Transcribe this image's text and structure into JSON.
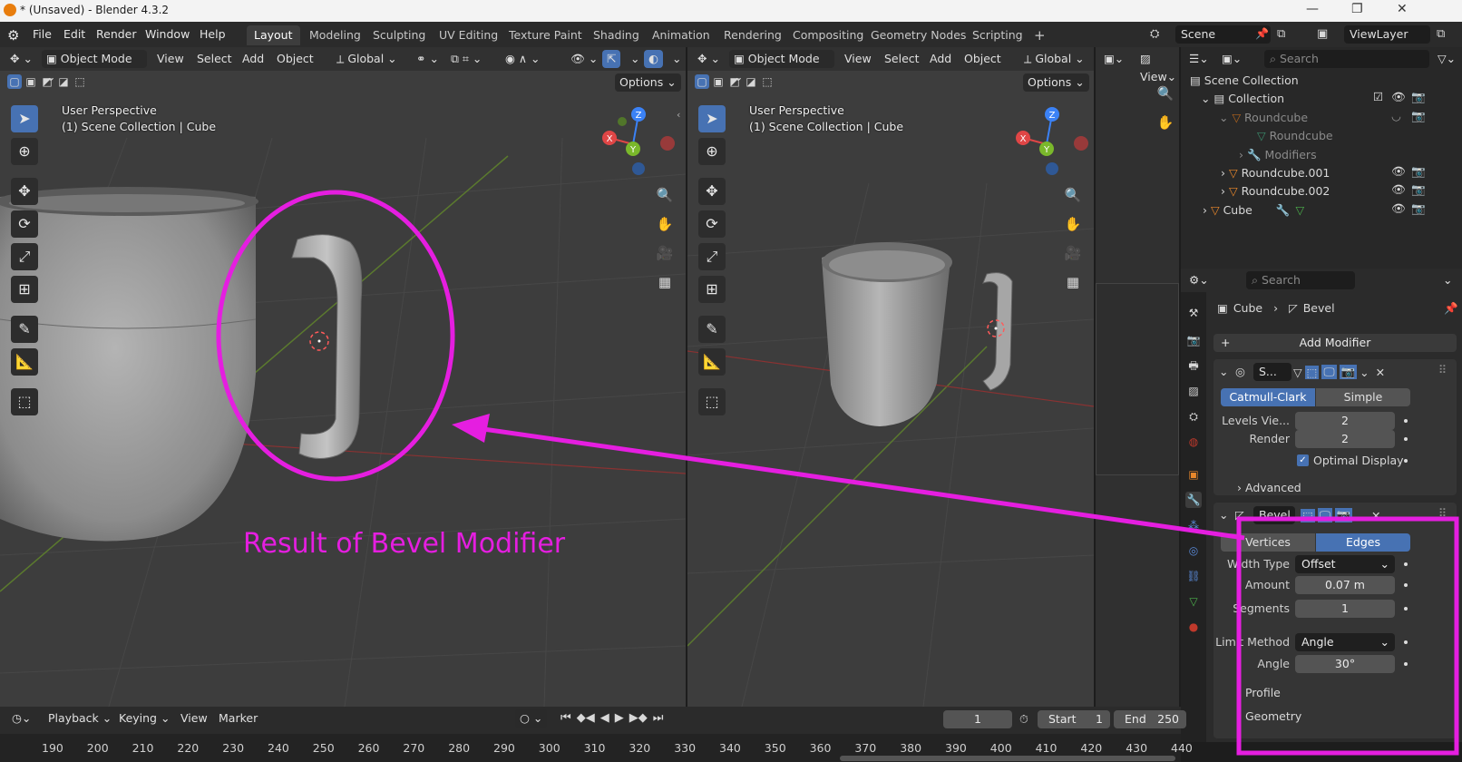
{
  "window": {
    "title": "* (Unsaved) - Blender 4.3.2",
    "controls": [
      "—",
      "❐",
      "✕"
    ]
  },
  "menu": [
    "File",
    "Edit",
    "Render",
    "Window",
    "Help"
  ],
  "workspaces": [
    "Layout",
    "Modeling",
    "Sculpting",
    "UV Editing",
    "Texture Paint",
    "Shading",
    "Animation",
    "Rendering",
    "Compositing",
    "Geometry Nodes",
    "Scripting",
    "+"
  ],
  "scene": {
    "name": "Scene",
    "view_layer": "ViewLayer"
  },
  "viewport_header": {
    "mode": "Object Mode",
    "menus": [
      "View",
      "Select",
      "Add",
      "Object"
    ],
    "orientation": "Global",
    "options": "Options"
  },
  "viewport_right_header": {
    "view": "View"
  },
  "viewport_overlay": {
    "perspective": "User Perspective",
    "collection": "(1) Scene Collection | Cube"
  },
  "gizmo": {
    "z": "Z",
    "x": "X",
    "y": "Y"
  },
  "annotation": {
    "text": "Result of Bevel Modifier",
    "color": "#e51ee0"
  },
  "outliner": {
    "search_placeholder": "Search",
    "rows": [
      {
        "label": "Scene Collection"
      },
      {
        "label": "Collection"
      },
      {
        "label": "Roundcube"
      },
      {
        "label": "Roundcube"
      },
      {
        "label": "Modifiers"
      },
      {
        "label": "Roundcube.001"
      },
      {
        "label": "Roundcube.002"
      },
      {
        "label": "Cube"
      }
    ]
  },
  "properties": {
    "search_placeholder": "Search",
    "breadcrumb": {
      "object": "Cube",
      "modifier": "Bevel"
    },
    "add_modifier": "Add Modifier",
    "subsurf": {
      "name": "S...",
      "algo_options": [
        "Catmull-Clark",
        "Simple"
      ],
      "levels_label": "Levels Vie...",
      "levels_value": "2",
      "render_label": "Render",
      "render_value": "2",
      "optimal_display": "Optimal Display",
      "advanced": "Advanced"
    },
    "bevel": {
      "name": "Bevel",
      "affect": [
        "Vertices",
        "Edges"
      ],
      "width_type_label": "Width Type",
      "width_type": "Offset",
      "amount_label": "Amount",
      "amount": "0.07 m",
      "segments_label": "Segments",
      "segments": "1",
      "limit_method_label": "Limit Method",
      "limit_method": "Angle",
      "angle_label": "Angle",
      "angle": "30°",
      "profile": "Profile",
      "geometry": "Geometry"
    }
  },
  "timeline": {
    "menus": [
      "Playback",
      "Keying",
      "View",
      "Marker"
    ],
    "current_frame": "1",
    "start_label": "Start",
    "start": "1",
    "end_label": "End",
    "end": "250",
    "ticks": [
      "190",
      "200",
      "210",
      "220",
      "230",
      "240",
      "250",
      "260",
      "270",
      "280",
      "290",
      "300",
      "310",
      "320",
      "330",
      "340",
      "350",
      "360",
      "370",
      "380",
      "390",
      "400",
      "410",
      "420",
      "430",
      "440"
    ]
  }
}
